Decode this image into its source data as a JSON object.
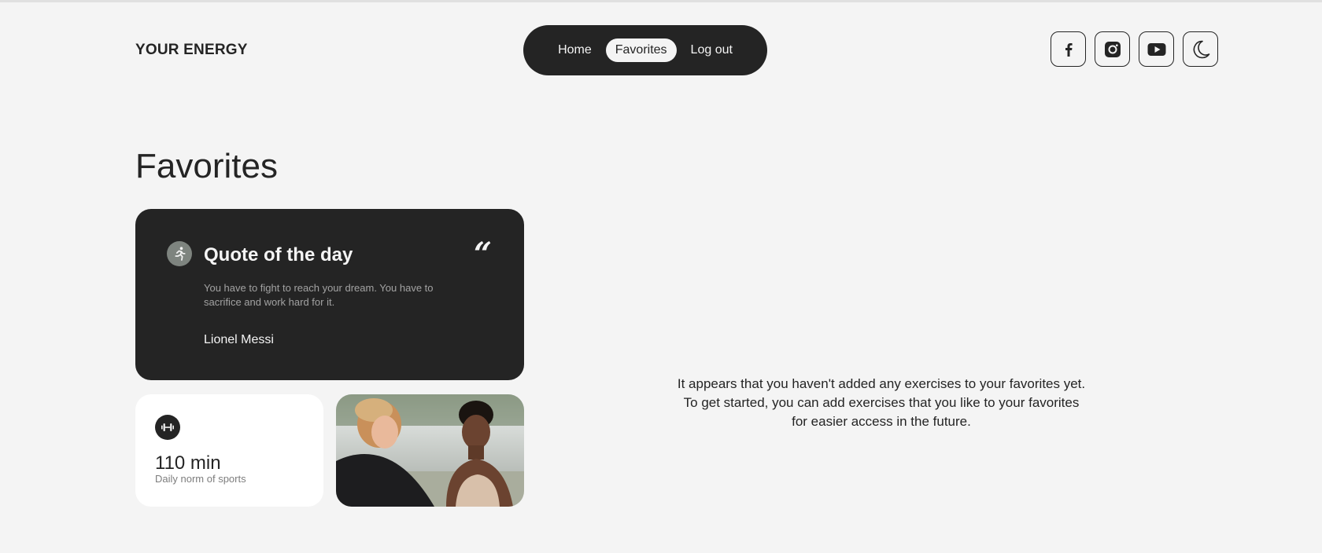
{
  "header": {
    "logo": "YOUR ENERGY",
    "nav": [
      {
        "label": "Home",
        "active": false
      },
      {
        "label": "Favorites",
        "active": true
      },
      {
        "label": "Log out",
        "active": false
      }
    ],
    "socials": [
      {
        "icon": "facebook-icon"
      },
      {
        "icon": "instagram-icon"
      },
      {
        "icon": "youtube-icon"
      },
      {
        "icon": "moon-icon"
      }
    ]
  },
  "page": {
    "title": "Favorites"
  },
  "quote": {
    "title": "Quote of the day",
    "text": "You have to fight to reach your dream. You have to sacrifice and work hard for it.",
    "author": "Lionel Messi",
    "icon": "runner-icon",
    "mark": "“"
  },
  "stat": {
    "icon": "dumbbell-icon",
    "value": "110 min",
    "label": "Daily norm of sports"
  },
  "empty": {
    "line1": "It appears that you haven't added any exercises to your favorites yet.",
    "line2": "To get started, you can add exercises that you like to your favorites",
    "line3": "for easier access in the future."
  },
  "colors": {
    "background": "#f4f4f4",
    "dark": "#242424",
    "card_white": "#ffffff",
    "icon_grey": "#7e847f"
  }
}
